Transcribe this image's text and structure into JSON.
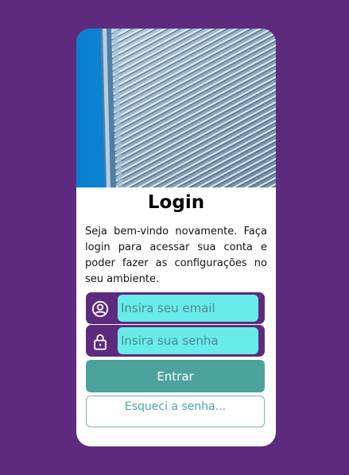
{
  "login": {
    "title": "Login",
    "description": "Seja bem-vindo novamente. Faça login para acessar sua conta e poder fazer as configurações no seu ambiente.",
    "email_placeholder": "Insira seu email",
    "password_placeholder": "Insira sua senha",
    "submit_label": "Entrar",
    "forgot_label": "Esqueci a senha..."
  },
  "icons": {
    "email_field": "user-circle-icon",
    "password_field": "padlock-icon"
  },
  "colors": {
    "background": "#5e2a7e",
    "card": "#ffffff",
    "field_band": "#5e2a7e",
    "input_fill": "#67ecea",
    "primary_button": "#4ca39b",
    "secondary_button_border": "#6fb8b1"
  }
}
